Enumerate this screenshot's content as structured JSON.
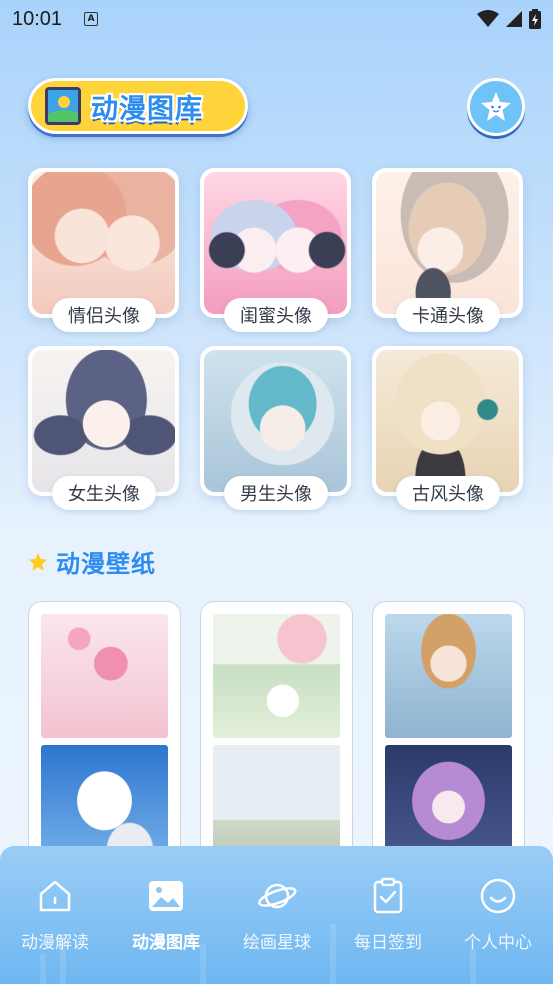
{
  "status_bar": {
    "time": "10:01",
    "notification_icon": "a-icon"
  },
  "header": {
    "title": "动漫图库",
    "title_icon": "gallery-icon",
    "favorite_icon": "star-face-icon"
  },
  "avatar_categories": [
    {
      "label": "情侣头像",
      "palette": [
        "#f6d9cf",
        "#f3b7a6",
        "#e8927f"
      ]
    },
    {
      "label": "闺蜜头像",
      "palette": [
        "#ffd5e4",
        "#f07aa3",
        "#7a8fbf"
      ]
    },
    {
      "label": "卡通头像",
      "palette": [
        "#fbe8df",
        "#e8c9b4",
        "#9a8fa0"
      ]
    },
    {
      "label": "女生头像",
      "palette": [
        "#f4f1ee",
        "#565a7a",
        "#b9c3dc"
      ]
    },
    {
      "label": "男生头像",
      "palette": [
        "#cfe3ee",
        "#5cb3c6",
        "#8da9c4"
      ]
    },
    {
      "label": "古风头像",
      "palette": [
        "#f5e9d6",
        "#e7cfa8",
        "#b64a38"
      ]
    }
  ],
  "wallpaper_section": {
    "title": "动漫壁纸",
    "icon": "star-icon"
  },
  "wallpapers": [
    {
      "top": [
        "#f7d6de",
        "#ef9fb8"
      ],
      "bottom": [
        "#4b8fd9",
        "#eaf1f8"
      ]
    },
    {
      "top": [
        "#dfeee0",
        "#f6c7d1"
      ],
      "bottom": [
        "#d7e3ee",
        "#9aa9a0"
      ]
    },
    {
      "top": [
        "#bcd6e8",
        "#f2d9c6"
      ],
      "bottom": [
        "#2f3b6a",
        "#b88ad6"
      ]
    }
  ],
  "bottom_nav": [
    {
      "label": "动漫解读",
      "icon": "home-icon",
      "active": false
    },
    {
      "label": "动漫图库",
      "icon": "image-icon",
      "active": true
    },
    {
      "label": "绘画星球",
      "icon": "planet-icon",
      "active": false
    },
    {
      "label": "每日签到",
      "icon": "clipboard-check-icon",
      "active": false
    },
    {
      "label": "个人中心",
      "icon": "smile-icon",
      "active": false
    }
  ]
}
